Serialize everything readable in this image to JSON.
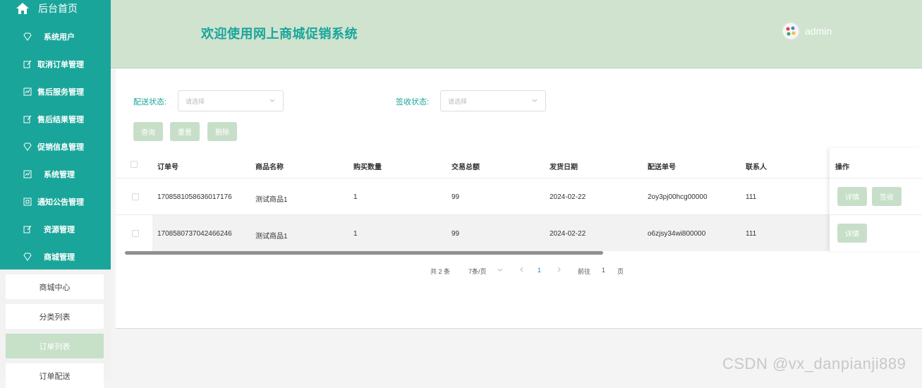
{
  "sidebar": {
    "home_label": "后台首页",
    "items": [
      {
        "label": "系统用户",
        "icon": "diamond-icon"
      },
      {
        "label": "取消订单管理",
        "icon": "edit-icon"
      },
      {
        "label": "售后服务管理",
        "icon": "chart-icon"
      },
      {
        "label": "售后结果管理",
        "icon": "edit-icon"
      },
      {
        "label": "促销信息管理",
        "icon": "diamond-icon"
      },
      {
        "label": "系统管理",
        "icon": "chart-icon"
      },
      {
        "label": "通知公告管理",
        "icon": "doc-icon"
      },
      {
        "label": "资源管理",
        "icon": "edit-icon"
      },
      {
        "label": "商城管理",
        "icon": "diamond-icon"
      }
    ],
    "subitems": [
      {
        "label": "商城中心"
      },
      {
        "label": "分类列表"
      },
      {
        "label": "订单列表",
        "active": true
      },
      {
        "label": "订单配送"
      }
    ]
  },
  "header": {
    "title": "欢迎使用网上商城促销系统",
    "user": "admin"
  },
  "filters": {
    "delivery_status_label": "配送状态:",
    "delivery_status_placeholder": "请选择",
    "receipt_status_label": "签收状态:",
    "receipt_status_placeholder": "请选择"
  },
  "buttons": {
    "query": "查询",
    "reset": "重置",
    "delete": "删除"
  },
  "table": {
    "columns": [
      "订单号",
      "商品名称",
      "购买数量",
      "交易总额",
      "发货日期",
      "配送单号",
      "联系人",
      "操作"
    ],
    "rows": [
      {
        "order_no": "1708581058636017176",
        "product": "测试商品1",
        "qty": "1",
        "total": "99",
        "date": "2024-02-22",
        "delivery_no": "2oy3pj00hcg00000",
        "contact": "111",
        "actions": [
          "详情",
          "签收"
        ]
      },
      {
        "order_no": "1708580737042466246",
        "product": "测试商品1",
        "qty": "1",
        "total": "99",
        "date": "2024-02-22",
        "delivery_no": "o6zjsy34wi800000",
        "contact": "111",
        "actions": [
          "详情"
        ]
      }
    ]
  },
  "pagination": {
    "total": "共 2 条",
    "page_size": "7条/页",
    "current_page": "1",
    "goto_prefix": "前往",
    "goto_value": "1",
    "goto_suffix": "页"
  },
  "watermark": "CSDN @vx_danpianji889",
  "colors": {
    "accent": "#1aa59a",
    "header_bg": "#cfe3cf",
    "button_bg": "#c7dfc8",
    "link": "#1a84d8"
  }
}
